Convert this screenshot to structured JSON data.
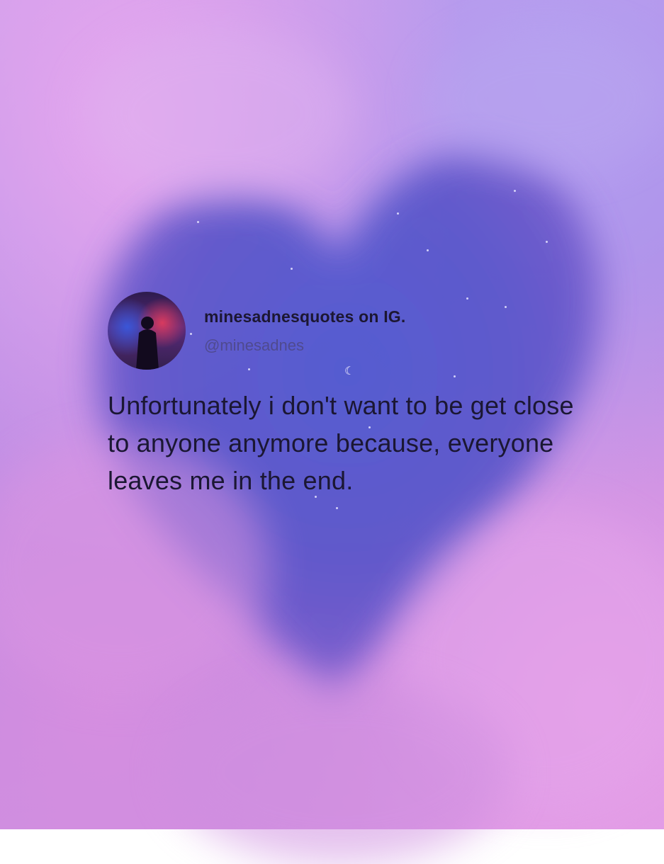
{
  "post": {
    "display_name": "minesadnesquotes on IG.",
    "handle": "@minesadnes",
    "text": "Unfortunately i don't want to be get close to anyone anymore because, everyone leaves me in the end."
  },
  "icons": {
    "avatar": "profile-avatar-silhouette",
    "moon": "crescent-moon-icon"
  },
  "colors": {
    "heart_sky": "#4a56c8",
    "cloud_pink": "#d895e3",
    "cloud_violet": "#a98ae6",
    "text_dark": "#1b1733",
    "handle_color": "#4f4a8f"
  }
}
